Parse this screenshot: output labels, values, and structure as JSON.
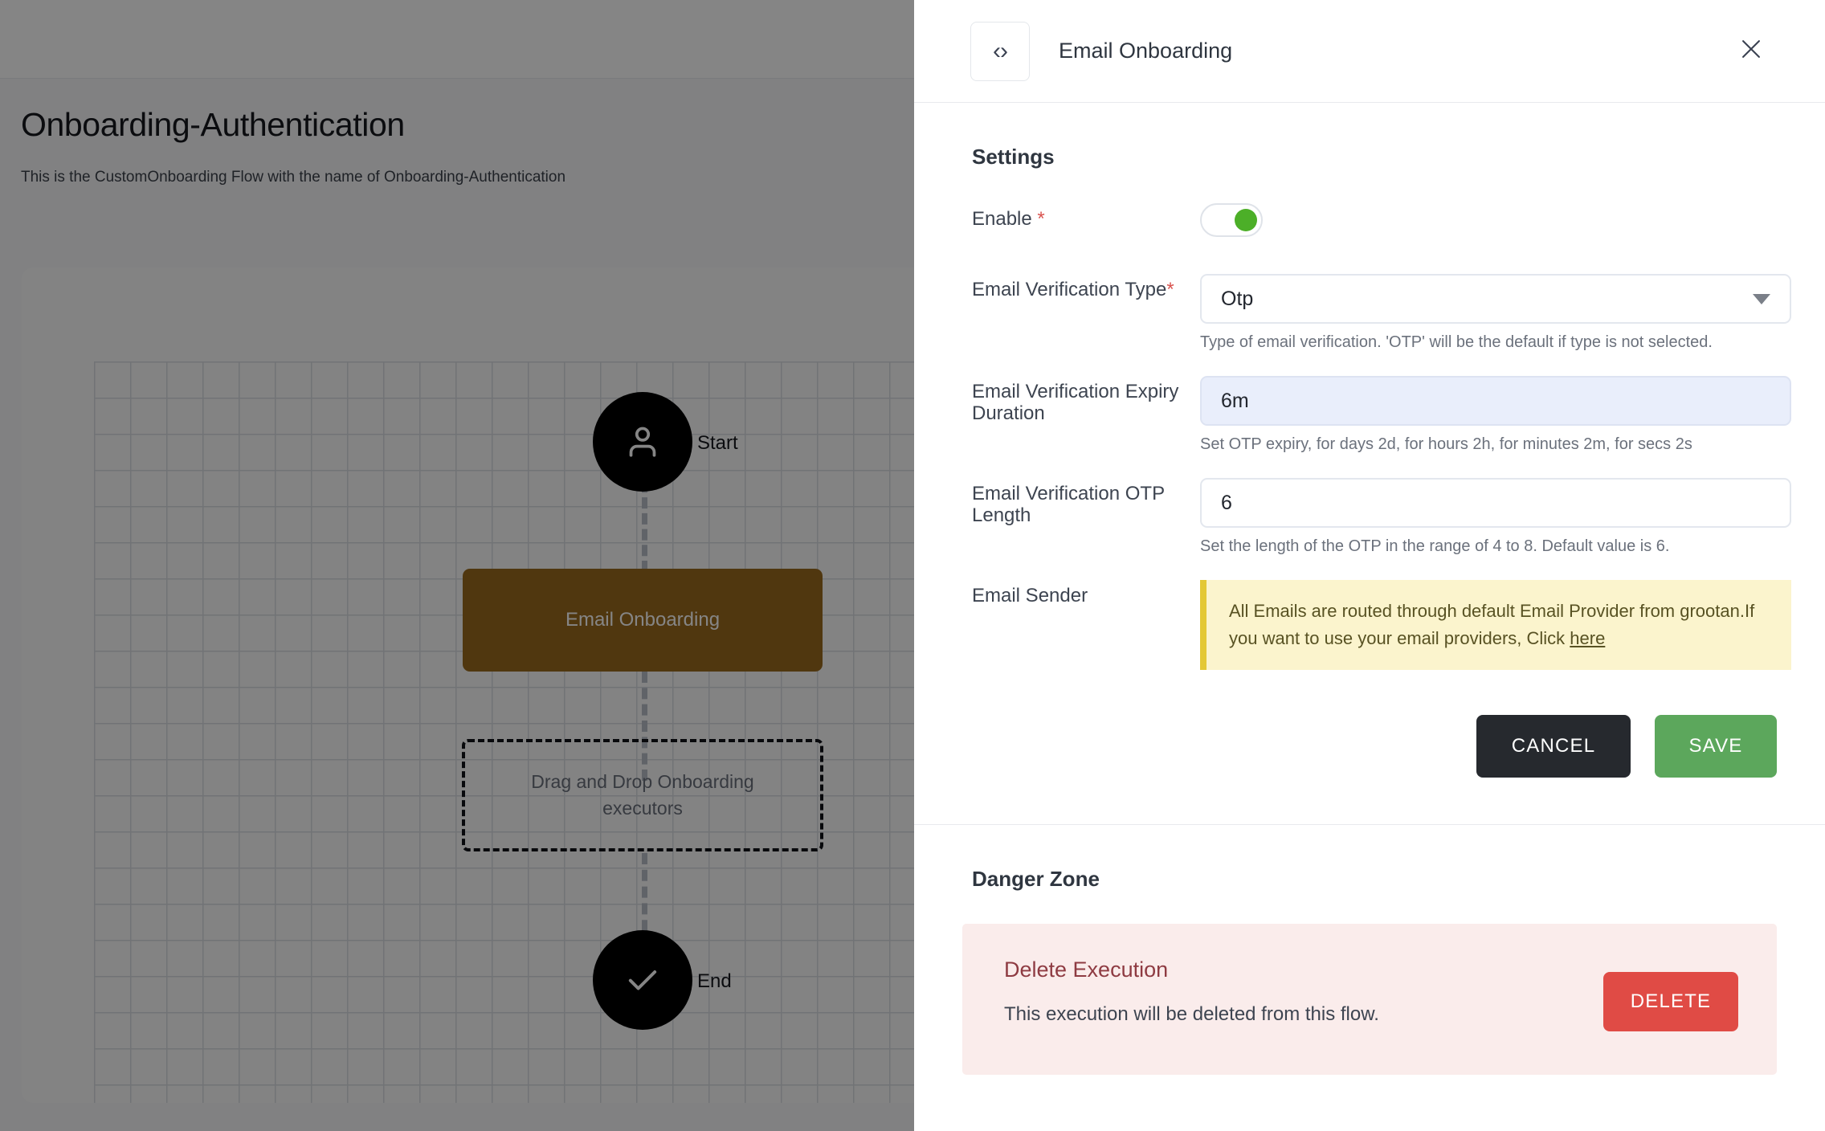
{
  "background": {
    "page_title": "Onboarding-Authentication",
    "page_subtitle": "This is the CustomOnboarding Flow with the name of Onboarding-Authentication",
    "flow": {
      "start_label": "Start",
      "end_label": "End",
      "node_label": "Email Onboarding",
      "dropzone_label": "Drag and Drop Onboarding executors",
      "node_color": "#9a6a1e"
    }
  },
  "panel": {
    "title": "Email Onboarding",
    "code_button_label": "‹›",
    "settings": {
      "heading": "Settings",
      "enable": {
        "label": "Enable ",
        "required_mark": "*",
        "state": "on",
        "knob_color": "#4caf28"
      },
      "verification_type": {
        "label": "Email Verification Type",
        "required_mark": "*",
        "value": "Otp",
        "helper": "Type of email verification. 'OTP' will be the default if type is not selected."
      },
      "expiry_duration": {
        "label": "Email Verification Expiry Duration",
        "value": "6m",
        "helper": "Set OTP expiry, for days 2d, for hours 2h, for minutes 2m, for secs 2s"
      },
      "otp_length": {
        "label": "Email Verification OTP Length",
        "value": "6",
        "helper": "Set the length of the OTP in the range of 4 to 8. Default value is 6."
      },
      "email_sender": {
        "label": "Email Sender",
        "notice_text": "All Emails are routed through default Email Provider from grootan.If you want to use your email providers, Click ",
        "notice_link": "here"
      },
      "cancel_label": "CANCEL",
      "save_label": "SAVE"
    },
    "danger_zone": {
      "heading": "Danger Zone",
      "delete_title": "Delete Execution",
      "delete_description": "This execution will be deleted from this flow.",
      "delete_label": "DELETE"
    }
  }
}
